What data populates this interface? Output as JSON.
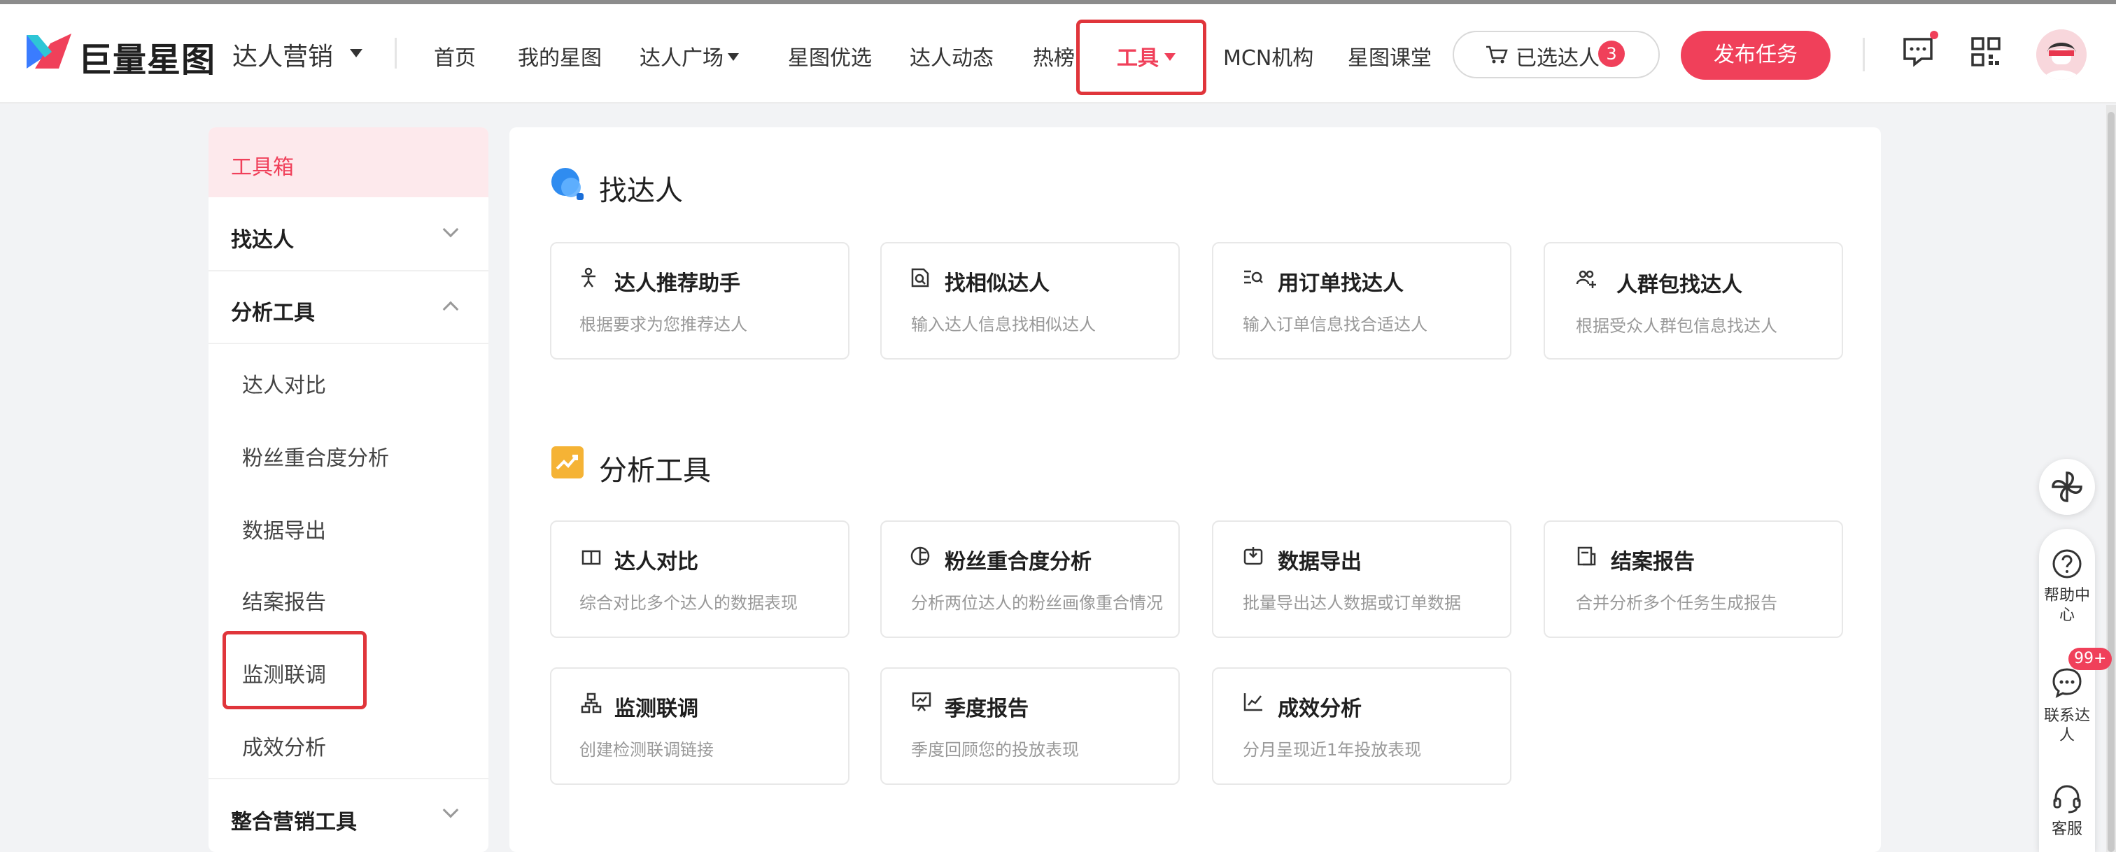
{
  "header": {
    "logo_text": "巨量星图",
    "product": "达人营销",
    "nav": [
      "首页",
      "我的星图",
      "达人广场",
      "星图优选",
      "达人动态",
      "热榜",
      "工具",
      "MCN机构",
      "星图课堂"
    ],
    "cart_label": "已选达人",
    "cart_count": "3",
    "publish_label": "发布任务"
  },
  "sidebar": {
    "active": "工具箱",
    "groups": {
      "find": "找达人",
      "analysis": "分析工具",
      "integrated": "整合营销工具"
    },
    "analysis_items": [
      "达人对比",
      "粉丝重合度分析",
      "数据导出",
      "结案报告",
      "监测联调",
      "成效分析"
    ]
  },
  "main": {
    "find_section": {
      "title": "找达人",
      "cards": [
        {
          "title": "达人推荐助手",
          "desc": "根据要求为您推荐达人"
        },
        {
          "title": "找相似达人",
          "desc": "输入达人信息找相似达人"
        },
        {
          "title": "用订单找达人",
          "desc": "输入订单信息找合适达人"
        },
        {
          "title": "人群包找达人",
          "desc": "根据受众人群包信息找达人"
        }
      ]
    },
    "analysis_section": {
      "title": "分析工具",
      "cards": [
        {
          "title": "达人对比",
          "desc": "综合对比多个达人的数据表现"
        },
        {
          "title": "粉丝重合度分析",
          "desc": "分析两位达人的粉丝画像重合情况"
        },
        {
          "title": "数据导出",
          "desc": "批量导出达人数据或订单数据"
        },
        {
          "title": "结案报告",
          "desc": "合并分析多个任务生成报告"
        },
        {
          "title": "监测联调",
          "desc": "创建检测联调链接"
        },
        {
          "title": "季度报告",
          "desc": "季度回顾您的投放表现"
        },
        {
          "title": "成效分析",
          "desc": "分月呈现近1年投放表现"
        }
      ]
    }
  },
  "right_float": {
    "help": "帮助中心",
    "contact": "联系达人",
    "contact_badge": "99+",
    "service": "客服"
  },
  "colors": {
    "brand": "#f0405a",
    "highlight_box": "#e0353b",
    "active_bg": "#fde9ec"
  },
  "icons": [
    "logo-icon",
    "cart-icon",
    "message-icon",
    "apps-grid-icon",
    "avatar",
    "search-bubble-icon",
    "trend-icon",
    "pinwheel-icon",
    "help-icon",
    "chat-icon",
    "headset-icon"
  ]
}
